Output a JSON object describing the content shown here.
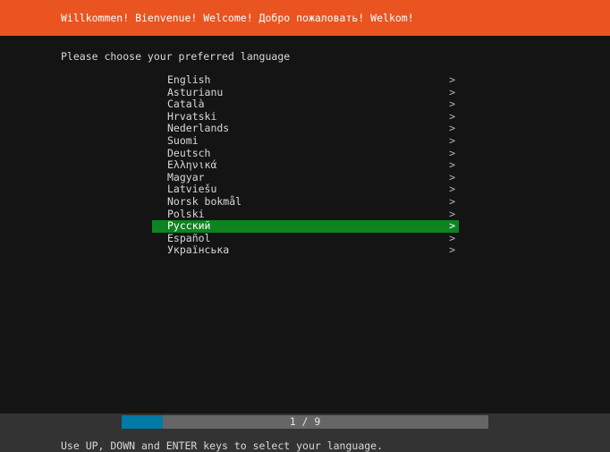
{
  "header": {
    "banner_text": "Willkommen! Bienvenue! Welcome! Добро пожаловать! Welkom!",
    "banner_color": "#e95420",
    "banner_text_color": "#ffffff"
  },
  "prompt": {
    "text": "Please choose your preferred language"
  },
  "language_list": {
    "chevron_glyph": ">",
    "selected_index": 12,
    "selected_bg": "#0e8420",
    "items": [
      {
        "label": "English"
      },
      {
        "label": "Asturianu"
      },
      {
        "label": "Català"
      },
      {
        "label": "Hrvatski"
      },
      {
        "label": "Nederlands"
      },
      {
        "label": "Suomi"
      },
      {
        "label": "Deutsch"
      },
      {
        "label": "Ελληνικά"
      },
      {
        "label": "Magyar"
      },
      {
        "label": "Latviešu"
      },
      {
        "label": "Norsk bokmål"
      },
      {
        "label": "Polski"
      },
      {
        "label": "Русский"
      },
      {
        "label": "Español"
      },
      {
        "label": "Українська"
      }
    ]
  },
  "footer": {
    "progress": {
      "text": "1 / 9",
      "current": 1,
      "total": 9,
      "fill_color": "#007aa6",
      "track_color": "#666666"
    },
    "hint": "Use UP, DOWN and ENTER keys to select your language."
  }
}
